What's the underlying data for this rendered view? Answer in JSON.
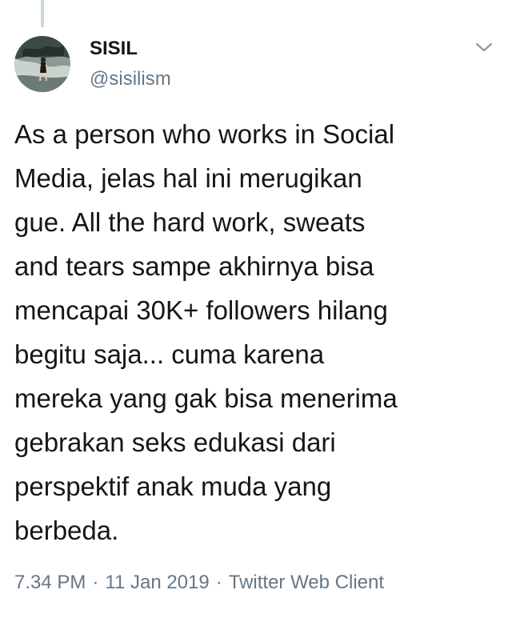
{
  "author": {
    "display_name": "SISIL",
    "handle": "@sisilism"
  },
  "icons": {
    "menu": "chevron-down-icon",
    "avatar": "avatar"
  },
  "tweet": {
    "text_lines": [
      "As a person who works in Social",
      "Media, jelas hal ini merugikan",
      "gue. All the hard work, sweats",
      "and tears sampe akhirnya bisa",
      "mencapai 30K+ followers hilang",
      "begitu saja... cuma karena",
      "mereka yang gak bisa menerima",
      "gebrakan seks edukasi dari",
      "perspektif anak muda yang",
      "berbeda."
    ]
  },
  "meta": {
    "time": "7.34 PM",
    "separator": "·",
    "date": "11 Jan 2019",
    "source": "Twitter Web Client"
  },
  "colors": {
    "text_primary": "#14171a",
    "text_secondary": "#657786",
    "thread_line": "#ccd6dd"
  }
}
